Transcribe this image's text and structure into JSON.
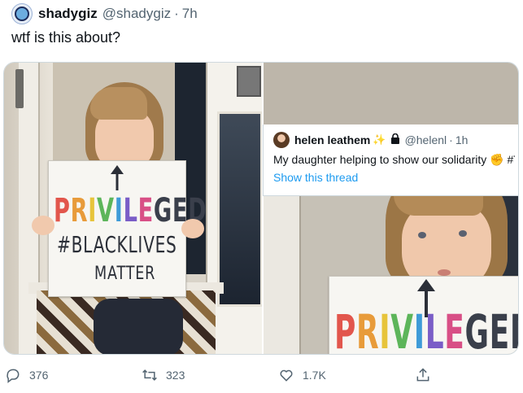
{
  "tweet": {
    "display_name": "shadygiz",
    "handle": "@shadygiz",
    "separator": "·",
    "time": "7h",
    "text": "wtf is this about?"
  },
  "quoted_tweet": {
    "display_name": "helen leathem",
    "badges": [
      "sparkles-icon",
      "lock-icon"
    ],
    "handle": "@helenl",
    "separator": "·",
    "time": "1h",
    "text": "My daughter helping to show our solidarity",
    "text_trailing": "#T",
    "show_thread_label": "Show this thread"
  },
  "photo_left": {
    "sign_line1_letters": [
      "P",
      "R",
      "I",
      "V",
      "I",
      "L",
      "E",
      "G",
      "E",
      "D"
    ],
    "sign_line1_colors": [
      "#e2564c",
      "#e89b3a",
      "#e7c43b",
      "#5db55a",
      "#3e9bd8",
      "#7a5dc7",
      "#d84f86",
      "#3a3f4b",
      "#3a3f4b",
      "#3a3f4b"
    ],
    "sign_line2": "#BLACKLIVES",
    "sign_line3": "MATTER"
  },
  "photo_right": {
    "sign_line1_letters": [
      "P",
      "R",
      "I",
      "V",
      "I",
      "L",
      "E",
      "G",
      "E",
      "D"
    ],
    "sign_line1_colors": [
      "#e2564c",
      "#e89b3a",
      "#e7c43b",
      "#5db55a",
      "#3e9bd8",
      "#7a5dc7",
      "#d84f86",
      "#3a3f4b",
      "#3a3f4b",
      "#3a3f4b"
    ]
  },
  "actions": {
    "replies": "376",
    "retweets": "323",
    "likes": "1.7K"
  },
  "colors": {
    "text_primary": "#0f1419",
    "text_secondary": "#536471",
    "link": "#1d9bf0",
    "border": "#cfd9de"
  }
}
